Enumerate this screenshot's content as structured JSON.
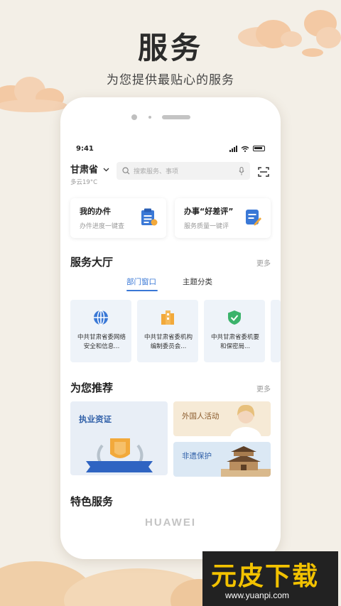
{
  "hero": {
    "title": "服务",
    "subtitle": "为您提供最贴心的服务"
  },
  "status_bar": {
    "time": "9:41"
  },
  "location": {
    "city": "甘肃省",
    "weather": "多云19°C"
  },
  "search": {
    "placeholder": "搜索服务、事项"
  },
  "quick_cards": [
    {
      "title": "我的办件",
      "desc": "办件进度一键查"
    },
    {
      "title": "办事“好差评”",
      "desc": "服务质量一键评"
    }
  ],
  "hall": {
    "title": "服务大厅",
    "more": "更多",
    "tabs": [
      {
        "label": "部门窗口",
        "active": true
      },
      {
        "label": "主题分类",
        "active": false
      }
    ],
    "tiles": [
      {
        "icon": "globe-shield-icon",
        "text": "中共甘肃省委网络安全和信息..."
      },
      {
        "icon": "building-icon",
        "text": "中共甘肃省委机构编制委员会..."
      },
      {
        "icon": "shield-check-icon",
        "text": "中共甘肃省委机要和保密局..."
      }
    ]
  },
  "recommend": {
    "title": "为您推荐",
    "more": "更多",
    "items": [
      {
        "label": "执业资证"
      },
      {
        "label": "外国人活动"
      },
      {
        "label": "非遗保护"
      }
    ]
  },
  "featured": {
    "title": "特色服务"
  },
  "device": {
    "brand": "HUAWEI"
  },
  "watermark": {
    "title": "元皮下载",
    "url": "www.yuanpi.com"
  },
  "colors": {
    "accent": "#3a78d6",
    "background": "#f3efe7",
    "cloud": "#f3c9a4"
  }
}
